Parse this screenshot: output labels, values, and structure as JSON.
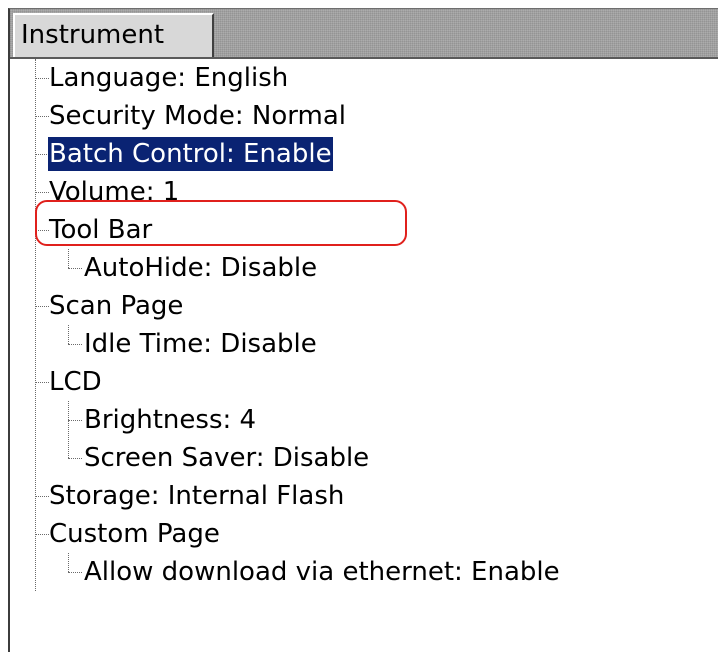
{
  "tab": {
    "label": "Instrument"
  },
  "tree": {
    "language": "Language: English",
    "security_mode": "Security Mode: Normal",
    "batch_control": "Batch Control: Enable",
    "volume": "Volume: 1",
    "tool_bar": "Tool Bar",
    "tool_bar_autohide": "AutoHide: Disable",
    "scan_page": "Scan Page",
    "scan_page_idle_time": "Idle Time: Disable",
    "lcd": "LCD",
    "lcd_brightness": "Brightness: 4",
    "lcd_screen_saver": "Screen Saver: Disable",
    "storage": "Storage: Internal Flash",
    "custom_page": "Custom Page",
    "custom_page_allow_download": "Allow download via ethernet: Enable"
  },
  "selected_item": "Batch Control: Enable",
  "colors": {
    "selection_bg": "#0a2373",
    "selection_fg": "#ffffff",
    "highlight_outline": "#e0201c",
    "tab_bar": "#a0a0a0"
  }
}
